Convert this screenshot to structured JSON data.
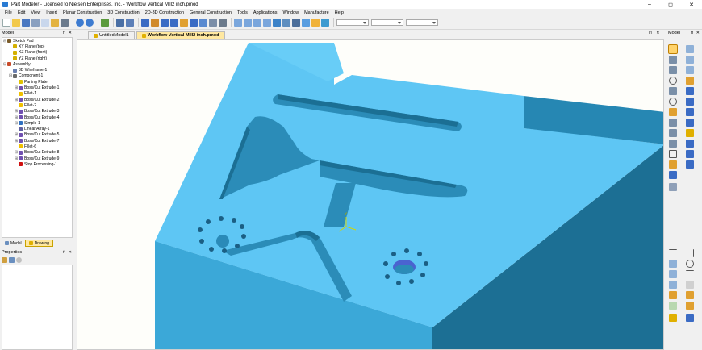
{
  "window": {
    "title": "Part Modeler - Licensed to Nielsen Enterprises, Inc. - Workflow Vertical Mill2 inch.pmod",
    "minimize": "–",
    "maximize": "◻",
    "close": "✕"
  },
  "menu": [
    "File",
    "Edit",
    "View",
    "Insert",
    "Planar Construction",
    "3D Construction",
    "2D-3D Construction",
    "General Construction",
    "Tools",
    "Applications",
    "Window",
    "Manufacture",
    "Help"
  ],
  "left_panel": {
    "header": "Model",
    "pins": "⊓ ✕",
    "tree": [
      {
        "label": "Sketch Pad",
        "level": 0,
        "expand": "⊟",
        "color": "#7a5b2a"
      },
      {
        "label": "XY Plane (top)",
        "level": 1,
        "expand": "",
        "color": "#d4b000"
      },
      {
        "label": "XZ Plane (front)",
        "level": 1,
        "expand": "",
        "color": "#d4b000"
      },
      {
        "label": "YZ Plane (right)",
        "level": 1,
        "expand": "",
        "color": "#d4b000"
      },
      {
        "label": "Assembly",
        "level": 0,
        "expand": "⊟",
        "color": "#c84b2a"
      },
      {
        "label": "3D Wireframe-1",
        "level": 1,
        "expand": "",
        "color": "#6a7fb0"
      },
      {
        "label": "Component-1",
        "level": 1,
        "expand": "⊟",
        "color": "#6a6a6a"
      },
      {
        "label": "Parting Plate",
        "level": 2,
        "expand": "",
        "color": "#e0c200"
      },
      {
        "label": "Boss/Cut Extrude-1",
        "level": 2,
        "expand": "⊞",
        "color": "#7050b0"
      },
      {
        "label": "Fillet-1",
        "level": 2,
        "expand": "",
        "color": "#f0c000"
      },
      {
        "label": "Boss/Cut Extrude-2",
        "level": 2,
        "expand": "⊞",
        "color": "#7050b0"
      },
      {
        "label": "Fillet-2",
        "level": 2,
        "expand": "",
        "color": "#f0c000"
      },
      {
        "label": "Boss/Cut Extrude-3",
        "level": 2,
        "expand": "⊞",
        "color": "#7050b0"
      },
      {
        "label": "Boss/Cut Extrude-4",
        "level": 2,
        "expand": "⊞",
        "color": "#7050b0"
      },
      {
        "label": "Simple-1",
        "level": 2,
        "expand": "⊞",
        "color": "#3070c0"
      },
      {
        "label": "Linear Array-1",
        "level": 2,
        "expand": "",
        "color": "#6060a0"
      },
      {
        "label": "Boss/Cut Extrude-5",
        "level": 2,
        "expand": "⊞",
        "color": "#7050b0"
      },
      {
        "label": "Boss/Cut Extrude-7",
        "level": 2,
        "expand": "⊞",
        "color": "#7050b0"
      },
      {
        "label": "Fillet-6",
        "level": 2,
        "expand": "",
        "color": "#f0c000"
      },
      {
        "label": "Boss/Cut Extrude-8",
        "level": 2,
        "expand": "⊞",
        "color": "#7050b0"
      },
      {
        "label": "Boss/Cut Extrude-9",
        "level": 2,
        "expand": "⊞",
        "color": "#7050b0"
      },
      {
        "label": "Stop Processing-1",
        "level": 2,
        "expand": "",
        "color": "#d01010"
      }
    ],
    "tabs": [
      {
        "label": "Model",
        "active": false
      },
      {
        "label": "Drawing",
        "active": true
      }
    ]
  },
  "properties_panel": {
    "header": "Properties",
    "pins": "⊓ ✕"
  },
  "document_tabs": [
    {
      "label": "UntitledModel1",
      "active": false
    },
    {
      "label": "Workflow Vertical Mill2 inch.pmod",
      "active": true
    }
  ],
  "doc_pins": "⊓ ✕",
  "right_panel": {
    "header": "Model",
    "pins": "⊓ ✕"
  },
  "viewport": {
    "part_color": "#5bc4f0",
    "top_color": "#5ec6f4",
    "side_color": "#3aa6d6",
    "dark_side_color": "#1c6f94",
    "pocket_color": "#2b8cb8",
    "hole_color": "#1b5f84",
    "background": "#fefefa",
    "triad_label": "Y"
  },
  "icons": {
    "toolbar": [
      "new-file-icon",
      "open-folder-icon",
      "save-icon",
      "cut-icon",
      "copy-icon",
      "paste-icon",
      "print-icon",
      "undo-icon",
      "redo-icon",
      "dollar-icon",
      "select-icon",
      "zoom-fit-icon",
      "render-icon",
      "feature-icon",
      "extrude-icon",
      "revolve-icon",
      "shell-icon",
      "fillet-icon",
      "chamfer-icon",
      "hole-icon",
      "sketch-icon",
      "view-iso-icon",
      "view-front-icon",
      "view-top-icon",
      "view-right-icon",
      "shaded-icon",
      "wireframe-icon",
      "measure-icon",
      "color-icon",
      "selection-filter-icon",
      "parameters-icon"
    ]
  }
}
